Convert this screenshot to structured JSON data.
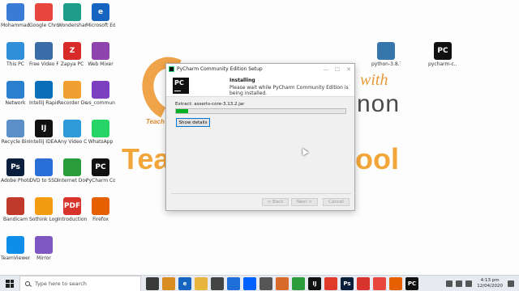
{
  "desktop": {
    "watermark": {
      "teach_small": "Teach",
      "with": "with",
      "hon": "non",
      "tea": "Tea",
      "ool": "ool"
    },
    "icons": [
      {
        "label": "Mohammad Waseem",
        "glyph": "",
        "color": "#3a7bd5",
        "icon": "user-folder-icon"
      },
      {
        "label": "Google Chrome",
        "glyph": "",
        "color": "#e8453c",
        "icon": "chrome-icon"
      },
      {
        "label": "Wondershare Filmora",
        "glyph": "",
        "color": "#1e9e8a",
        "icon": "filmora-icon"
      },
      {
        "label": "Microsoft Edge",
        "glyph": "e",
        "color": "#1565c0",
        "icon": "edge-icon"
      },
      {
        "label": "This PC",
        "glyph": "",
        "color": "#2f8fd8",
        "icon": "computer-icon"
      },
      {
        "label": "Free Video Recorder",
        "glyph": "",
        "color": "#3b6ea8",
        "icon": "video-recorder-icon"
      },
      {
        "label": "Zapya PC",
        "glyph": "Z",
        "color": "#d92a2a",
        "icon": "zapya-icon"
      },
      {
        "label": "Web Mixer",
        "glyph": "",
        "color": "#8e44ad",
        "icon": "web-mixer-icon"
      },
      {
        "label": "Network",
        "glyph": "",
        "color": "#2a7fcf",
        "icon": "network-icon"
      },
      {
        "label": "IntelliJ Rapid Storage Te...",
        "glyph": "",
        "color": "#0a6fb8",
        "icon": "intel-icon"
      },
      {
        "label": "Recorder Deskcam",
        "glyph": "",
        "color": "#f0a030",
        "icon": "recorder-icon"
      },
      {
        "label": "vs_commun...",
        "glyph": "",
        "color": "#7b3fbf",
        "icon": "visual-studio-icon"
      },
      {
        "label": "Recycle Bin",
        "glyph": "",
        "color": "#5a8fc8",
        "icon": "recycle-bin-icon"
      },
      {
        "label": "IntelliJ IDEA Communit...",
        "glyph": "IJ",
        "color": "#111111",
        "icon": "intellij-icon"
      },
      {
        "label": "Any Video Converter",
        "glyph": "",
        "color": "#2e9ad8",
        "icon": "video-converter-icon"
      },
      {
        "label": "WhatsApp",
        "glyph": "",
        "color": "#25d366",
        "icon": "whatsapp-icon"
      },
      {
        "label": "Adobe Photosh...",
        "glyph": "Ps",
        "color": "#0a1f3c",
        "icon": "photoshop-icon"
      },
      {
        "label": "DVD to SSD",
        "glyph": "",
        "color": "#2a6fd8",
        "icon": "dvd-icon"
      },
      {
        "label": "Internet Downlo...",
        "glyph": "",
        "color": "#2a9c3c",
        "icon": "download-manager-icon"
      },
      {
        "label": "PyCharm Communit...",
        "glyph": "PC",
        "color": "#111111",
        "icon": "pycharm-icon"
      },
      {
        "label": "Bandicam",
        "glyph": "",
        "color": "#c0392b",
        "icon": "bandicam-icon"
      },
      {
        "label": "Sothink Logo Maker Prof...",
        "glyph": "",
        "color": "#f39c12",
        "icon": "logo-maker-icon"
      },
      {
        "label": "Introduction...",
        "glyph": "PDF",
        "color": "#d9342b",
        "icon": "pdf-icon"
      },
      {
        "label": "Firefox",
        "glyph": "",
        "color": "#e66000",
        "icon": "firefox-icon"
      },
      {
        "label": "TeamViewer",
        "glyph": "",
        "color": "#0e8ee9",
        "icon": "teamviewer-icon"
      },
      {
        "label": "Mirror",
        "glyph": "",
        "color": "#7e57c2",
        "icon": "mirror-icon"
      }
    ],
    "right_icons": [
      {
        "label": "python-3.8.7",
        "glyph": "",
        "color": "#3776ab",
        "icon": "python-installer-icon"
      },
      {
        "label": "pycharm-c...",
        "glyph": "PC",
        "color": "#111111",
        "icon": "pycharm-installer-icon"
      }
    ]
  },
  "dialog": {
    "title": "PyCharm Community Edition Setup",
    "minimize": "—",
    "maximize": "☐",
    "close": "✕",
    "logo": "PC",
    "heading": "Installing",
    "description": "Please wait while PyCharm Community Edition is being installed.",
    "extract_text": "Extract: asserts-core-3.13.2.jar",
    "progress": 0.07,
    "show_details_label": "Show details",
    "back_label": "< Back",
    "next_label": "Next >",
    "cancel_label": "Cancel"
  },
  "taskbar": {
    "search_placeholder": "Type here to search",
    "apps": [
      {
        "glyph": "",
        "color": "#3a3a3a",
        "icon": "task-view-icon"
      },
      {
        "glyph": "",
        "color": "#d98c1f",
        "icon": "bandicam-taskbar-icon"
      },
      {
        "glyph": "e",
        "color": "#1565c0",
        "icon": "edge-taskbar-icon"
      },
      {
        "glyph": "",
        "color": "#e8b53c",
        "icon": "file-explorer-icon"
      },
      {
        "glyph": "",
        "color": "#444444",
        "icon": "store-icon"
      },
      {
        "glyph": "",
        "color": "#1e6fd9",
        "icon": "mail-icon"
      },
      {
        "glyph": "",
        "color": "#0061fe",
        "icon": "dropbox-icon"
      },
      {
        "glyph": "",
        "color": "#555555",
        "icon": "settings-taskbar-icon"
      },
      {
        "glyph": "",
        "color": "#d86a2a",
        "icon": "vlc-icon"
      },
      {
        "glyph": "",
        "color": "#2a9c3c",
        "icon": "whatsapp-taskbar-icon"
      },
      {
        "glyph": "IJ",
        "color": "#111111",
        "icon": "intellij-taskbar-icon"
      },
      {
        "glyph": "",
        "color": "#e03a2a",
        "icon": "ms-taskbar-icon"
      },
      {
        "glyph": "Ps",
        "color": "#0a1f3c",
        "icon": "photoshop-taskbar-icon"
      },
      {
        "glyph": "",
        "color": "#d9342b",
        "icon": "recorder-taskbar-icon"
      },
      {
        "glyph": "",
        "color": "#e8453c",
        "icon": "chrome-taskbar-icon"
      },
      {
        "glyph": "",
        "color": "#e66000",
        "icon": "firefox-taskbar-icon"
      },
      {
        "glyph": "PC",
        "color": "#111111",
        "icon": "pycharm-taskbar-icon"
      }
    ],
    "time": "4:13 pm",
    "date": "12/04/2020"
  }
}
